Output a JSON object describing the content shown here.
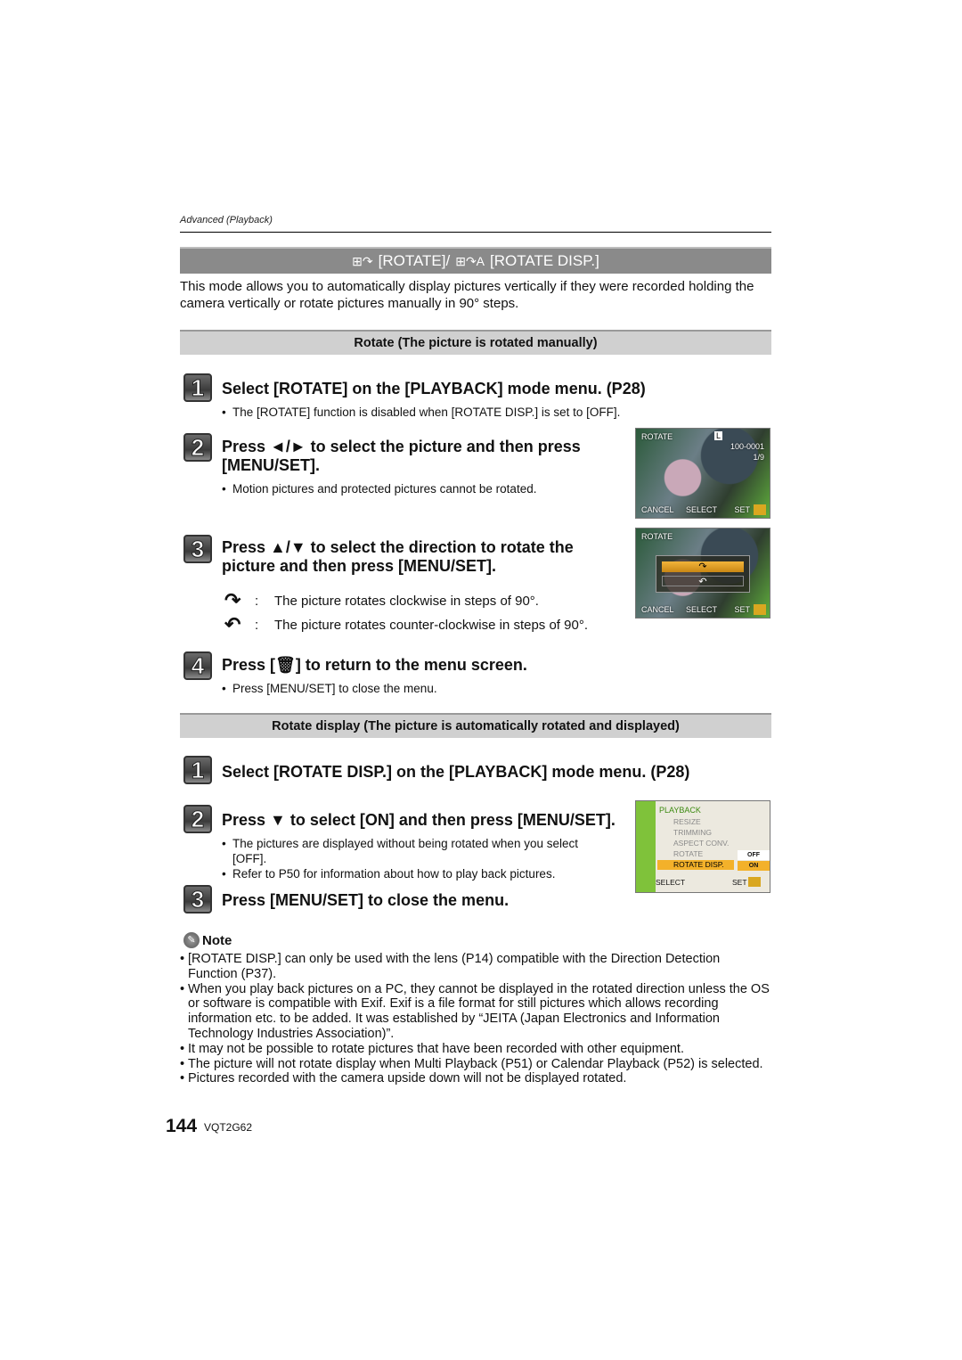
{
  "header": {
    "breadcrumb": "Advanced (Playback)",
    "title": "[ROTATE]/ [ROTATE DISP.]",
    "title_part1": "[ROTATE]/",
    "title_part2": "[ROTATE DISP.]",
    "icon_rotate": "rotate-icon",
    "icon_rotate_disp": "rotate-disp-icon"
  },
  "intro": "This mode allows you to automatically display pictures vertically if they were recorded holding the camera vertically or rotate pictures manually in 90° steps.",
  "section_rotate": {
    "heading": "Rotate (The picture is rotated manually)",
    "steps": [
      {
        "num": "1",
        "text": "Select [ROTATE] on the [PLAYBACK] mode menu. (P28)",
        "bullets": [
          "The [ROTATE] function is disabled when [ROTATE DISP.] is set to [OFF]."
        ]
      },
      {
        "num": "2",
        "text": "Press ◄/► to select the picture and then press [MENU/SET].",
        "bullets": [
          "Motion pictures and protected pictures cannot be rotated."
        ]
      },
      {
        "num": "3",
        "text": "Press ▲/▼ to select the direction to rotate the picture and then press [MENU/SET].",
        "arrows": [
          {
            "icon": "clockwise-arrow-icon",
            "glyph": "↷",
            "text": "The picture rotates clockwise in steps of 90°."
          },
          {
            "icon": "counter-clockwise-arrow-icon",
            "glyph": "↶",
            "text": "The picture rotates counter-clockwise in steps of 90°."
          }
        ]
      },
      {
        "num": "4",
        "text": "Press [🗑] to return to the menu screen.",
        "bullets": [
          "Press [MENU/SET] to close the menu."
        ]
      }
    ],
    "screen1": {
      "mode": "ROTATE",
      "size": "L",
      "file": "100-0001",
      "count": "1/9",
      "cancel": "CANCEL",
      "select": "SELECT",
      "set": "SET"
    },
    "screen2": {
      "mode": "ROTATE",
      "cancel": "CANCEL",
      "select": "SELECT",
      "set": "SET"
    }
  },
  "section_rotate_disp": {
    "heading": "Rotate display (The picture is automatically rotated and displayed)",
    "steps": [
      {
        "num": "1",
        "text": "Select [ROTATE DISP.] on the [PLAYBACK] mode menu. (P28)"
      },
      {
        "num": "2",
        "text": "Press ▼ to select [ON] and then press [MENU/SET].",
        "bullets": [
          "The pictures are displayed without being rotated when you select [OFF].",
          "Refer to P50 for information about how to play back pictures."
        ]
      },
      {
        "num": "3",
        "text": "Press [MENU/SET] to close the menu."
      }
    ],
    "menu_screen": {
      "title": "PLAYBACK",
      "items": [
        "RESIZE",
        "TRIMMING",
        "ASPECT CONV.",
        "ROTATE",
        "ROTATE DISP."
      ],
      "options": [
        "OFF",
        "ON"
      ],
      "selected_option": "ON",
      "select_label": "SELECT",
      "set_label": "SET"
    }
  },
  "note": {
    "title": "Note",
    "items": [
      "[ROTATE DISP.] can only be used with the lens (P14) compatible with the Direction Detection Function (P37).",
      "When you play back pictures on a PC, they cannot be displayed in the rotated direction unless the OS or software is compatible with Exif. Exif is a file format for still pictures which allows recording information etc. to be added. It was established by “JEITA (Japan Electronics and Information Technology Industries Association)”.",
      "It may not be possible to rotate pictures that have been recorded with other equipment.",
      "The picture will not rotate display when Multi Playback (P51) or Calendar Playback (P52) is selected.",
      "Pictures recorded with the camera upside down will not be displayed rotated."
    ]
  },
  "footer": {
    "page": "144",
    "code": "VQT2G62"
  }
}
